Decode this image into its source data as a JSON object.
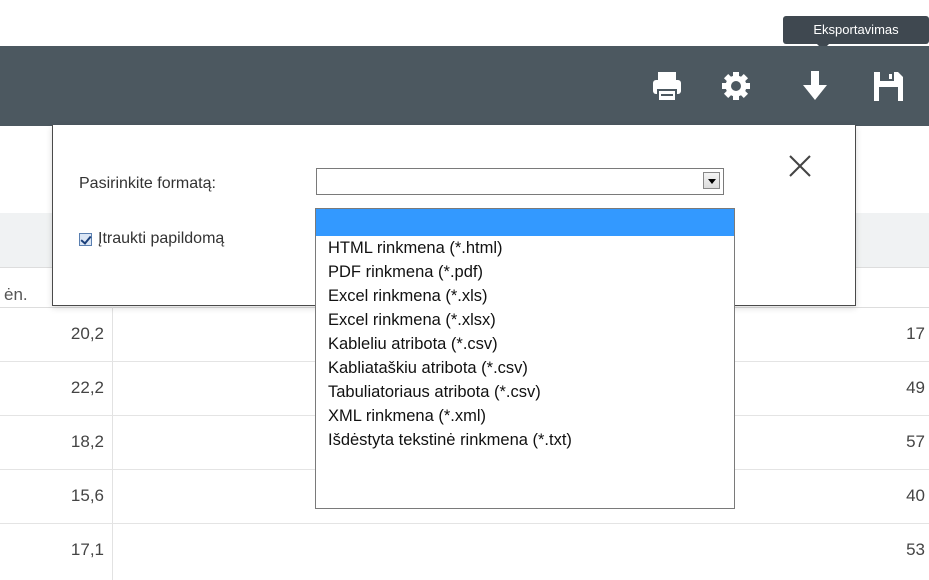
{
  "tooltip": "Eksportavimas",
  "toolbar": {
    "buttons": [
      "printer-icon",
      "gear-icon",
      "download-icon",
      "save-icon"
    ]
  },
  "table": {
    "column_header_fragment": "ėn.",
    "rows": [
      {
        "left": "20,2",
        "right": "17"
      },
      {
        "left": "22,2",
        "right": "49"
      },
      {
        "left": "18,2",
        "right": "57"
      },
      {
        "left": "15,6",
        "right": "40"
      },
      {
        "left": "17,1",
        "right": "53"
      }
    ]
  },
  "modal": {
    "format_label": "Pasirinkite formatą:",
    "select_value": "",
    "checkbox_label": "Įtraukti papildomą",
    "checkbox_checked": true,
    "close_icon": "close-icon"
  },
  "dropdown": {
    "options": [
      "HTML rinkmena (*.html)",
      "PDF rinkmena (*.pdf)",
      "Excel rinkmena (*.xls)",
      "Excel rinkmena (*.xlsx)",
      "Kableliu atribota (*.csv)",
      "Kabliataškiu atribota (*.csv)",
      "Tabuliatoriaus atribota (*.csv)",
      "XML rinkmena (*.xml)",
      "Išdėstyta tekstinė rinkmena (*.txt)"
    ]
  },
  "colors": {
    "toolbar": "#4c5860",
    "highlight": "#3399ff"
  }
}
